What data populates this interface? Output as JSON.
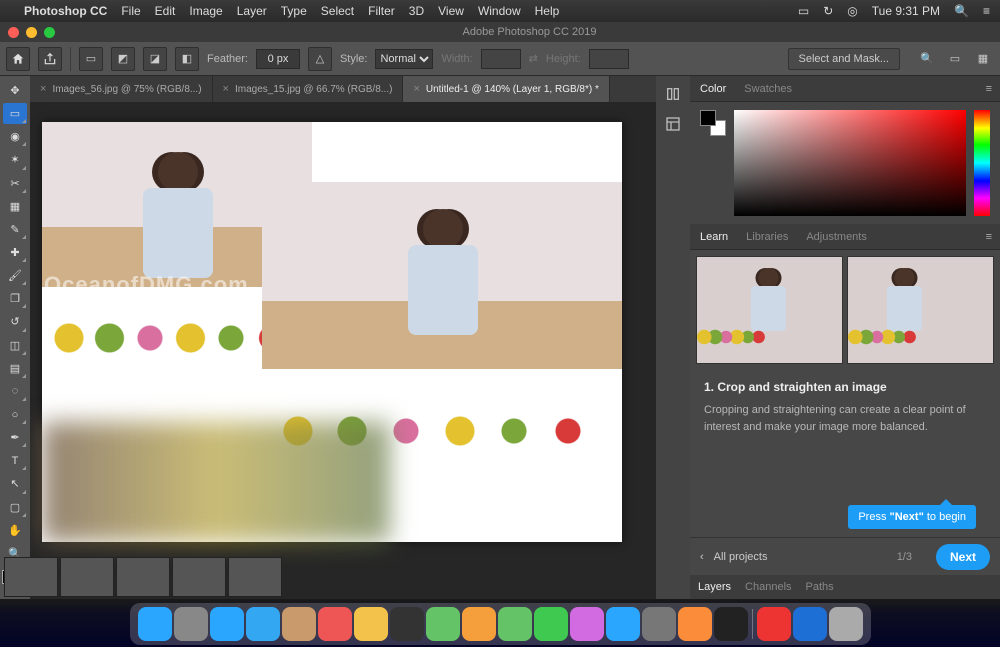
{
  "menubar": {
    "app": "Photoshop CC",
    "items": [
      "File",
      "Edit",
      "Image",
      "Layer",
      "Type",
      "Select",
      "Filter",
      "3D",
      "View",
      "Window",
      "Help"
    ],
    "clock": "Tue 9:31 PM"
  },
  "window": {
    "title": "Adobe Photoshop CC 2019"
  },
  "options": {
    "feather_label": "Feather:",
    "feather_value": "0 px",
    "style_label": "Style:",
    "style_value": "Normal",
    "width_label": "Width:",
    "height_label": "Height:",
    "mask_button": "Select and Mask..."
  },
  "docs": {
    "tabs": [
      {
        "label": "Images_56.jpg @ 75% (RGB/8...)"
      },
      {
        "label": "Images_15.jpg @ 66.7% (RGB/8...)"
      },
      {
        "label": "Untitled-1 @ 140% (Layer 1, RGB/8*) *"
      }
    ]
  },
  "watermark": "OceanofDMG.com",
  "panels": {
    "color": {
      "tabs": [
        "Color",
        "Swatches"
      ]
    },
    "learn": {
      "tabs": [
        "Learn",
        "Libraries",
        "Adjustments"
      ],
      "title": "1.  Crop and straighten an image",
      "body": "Cropping and straightening can create a clear point of interest and make your image more balanced.",
      "all": "All projects",
      "page": "1/3",
      "next": "Next",
      "tooltip_pre": "Press ",
      "tooltip_q": "\"Next\"",
      "tooltip_post": " to begin"
    },
    "bottom": {
      "tabs": [
        "Layers",
        "Channels",
        "Paths"
      ]
    }
  },
  "tool_names": [
    "move",
    "marquee",
    "lasso",
    "quick-select",
    "crop",
    "frame",
    "eyedropper",
    "heal",
    "brush",
    "clone",
    "history-brush",
    "eraser",
    "gradient",
    "blur",
    "dodge",
    "pen",
    "type",
    "path-select",
    "rectangle",
    "hand",
    "zoom"
  ],
  "dock_icons": [
    "finder",
    "launchpad",
    "safari",
    "mail",
    "contacts",
    "calendar",
    "notes",
    "reminders",
    "maps",
    "photos",
    "messages",
    "facetime",
    "itunes",
    "appstore",
    "system",
    "ibooks",
    "terminal",
    "magnet",
    "photoshop",
    "trash"
  ],
  "dock_colors": [
    "#2aa6ff",
    "#888",
    "#2aa6ff",
    "#34a7f3",
    "#c99a6b",
    "#e55",
    "#f3c24a",
    "#333",
    "#65c367",
    "#f59f3c",
    "#65c367",
    "#40c950",
    "#d26be2",
    "#2aa6ff",
    "#777",
    "#fb8d3a",
    "#222",
    "#e33",
    "#1d6fd6",
    "#aaa"
  ]
}
